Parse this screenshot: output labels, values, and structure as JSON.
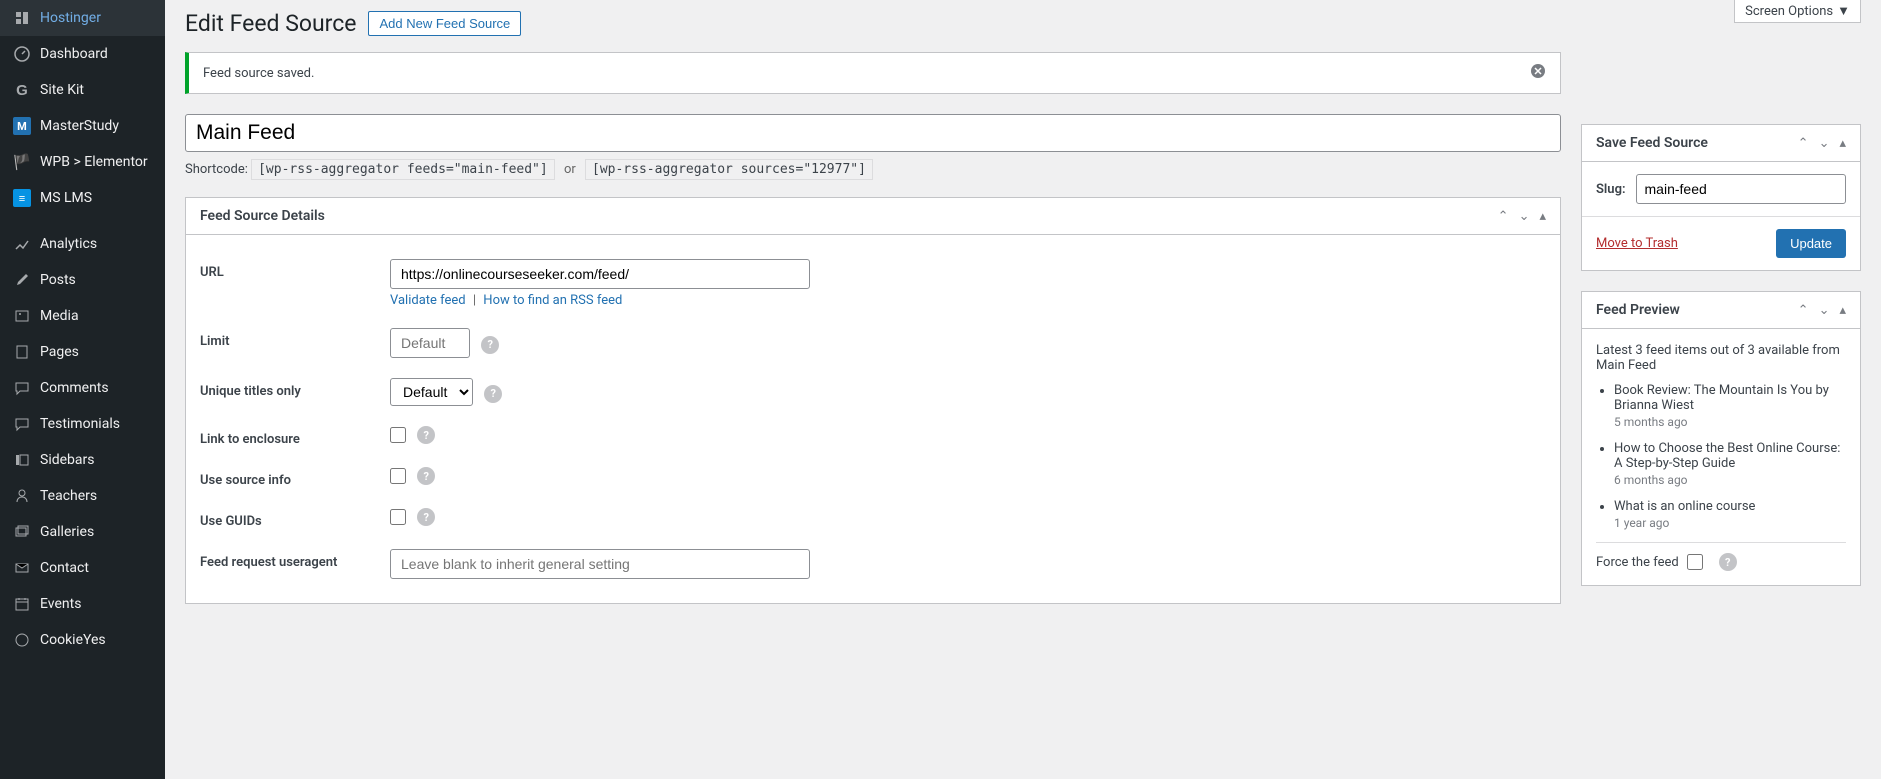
{
  "screen_options_label": "Screen Options",
  "sidebar": {
    "items": [
      {
        "label": "Hostinger",
        "icon": "hostinger"
      },
      {
        "label": "Dashboard",
        "icon": "dashboard"
      },
      {
        "label": "Site Kit",
        "icon": "g"
      },
      {
        "label": "MasterStudy",
        "icon": "M"
      },
      {
        "label": "WPB > Elementor",
        "icon": "flag"
      },
      {
        "label": "MS LMS",
        "icon": "ms"
      },
      {
        "label": "Analytics",
        "icon": "analytics"
      },
      {
        "label": "Posts",
        "icon": "posts"
      },
      {
        "label": "Media",
        "icon": "media"
      },
      {
        "label": "Pages",
        "icon": "pages"
      },
      {
        "label": "Comments",
        "icon": "comments"
      },
      {
        "label": "Testimonials",
        "icon": "testimonials"
      },
      {
        "label": "Sidebars",
        "icon": "sidebars"
      },
      {
        "label": "Teachers",
        "icon": "teachers"
      },
      {
        "label": "Galleries",
        "icon": "galleries"
      },
      {
        "label": "Contact",
        "icon": "contact"
      },
      {
        "label": "Events",
        "icon": "events"
      },
      {
        "label": "CookieYes",
        "icon": "cookieyes"
      }
    ]
  },
  "header": {
    "page_title": "Edit Feed Source",
    "add_new_label": "Add New Feed Source"
  },
  "notice": {
    "message": "Feed source saved."
  },
  "title_value": "Main Feed",
  "shortcode": {
    "label": "Shortcode:",
    "code1": "[wp-rss-aggregator feeds=\"main-feed\"]",
    "or": "or",
    "code2": "[wp-rss-aggregator sources=\"12977\"]"
  },
  "details": {
    "panel_title": "Feed Source Details",
    "url_label": "URL",
    "url_value": "https://onlinecourseseeker.com/feed/",
    "validate_link": "Validate feed",
    "howto_link": "How to find an RSS feed",
    "limit_label": "Limit",
    "limit_placeholder": "Default",
    "unique_titles_label": "Unique titles only",
    "unique_titles_value": "Default",
    "link_enclosure_label": "Link to enclosure",
    "use_source_info_label": "Use source info",
    "use_guids_label": "Use GUIDs",
    "useragent_label": "Feed request useragent",
    "useragent_placeholder": "Leave blank to inherit general setting"
  },
  "save_box": {
    "title": "Save Feed Source",
    "slug_label": "Slug:",
    "slug_value": "main-feed",
    "trash_label": "Move to Trash",
    "update_label": "Update"
  },
  "preview_box": {
    "title": "Feed Preview",
    "summary": "Latest 3 feed items out of 3 available from Main Feed",
    "items": [
      {
        "title": "Book Review: The Mountain Is You by Brianna Wiest",
        "ago": "5 months ago"
      },
      {
        "title": "How to Choose the Best Online Course: A Step-by-Step Guide",
        "ago": "6 months ago"
      },
      {
        "title": "What is an online course",
        "ago": "1 year ago"
      }
    ],
    "force_label": "Force the feed"
  }
}
